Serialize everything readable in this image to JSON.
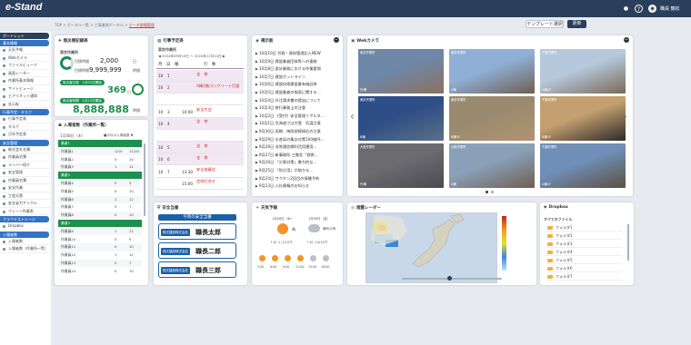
{
  "app": {
    "logo": "e-Stand",
    "user": "職員 鶴松"
  },
  "breadcrumb": {
    "items": [
      "TOP",
      "ポータル一覧",
      "工事業務ポータル"
    ],
    "current": "データ現場管理"
  },
  "toolbar": {
    "template_label": "テンプレート選択",
    "update_label": "更新"
  },
  "sidebar": {
    "sections": [
      {
        "title": "ポートレット",
        "items": []
      },
      {
        "title": "基本情報",
        "items": [
          "天気予報",
          "Webカメラ",
          "ファイルビューア",
          "画面レーダー",
          "作業所基本情報",
          "サイトビュージ",
          "ヒアリネット通知",
          "告示板"
        ]
      },
      {
        "title": "行事予定・タスク",
        "items": [
          "行事予定表",
          "タスク",
          "月年予定表"
        ]
      },
      {
        "title": "安全管理",
        "items": [
          "株式会社名簿",
          "作業員名簿",
          "メンバー紹介",
          "安全管理",
          "作業員名簿",
          "安全作業",
          "工程天票",
          "安全省力サイクル",
          "クレーン作業表"
        ]
      },
      {
        "title": "クラウドストレージ",
        "items": [
          "Dropbox"
        ]
      },
      {
        "title": "入場者数",
        "items": [
          "入場者数",
          "入場者数（作業所一覧）"
        ]
      }
    ]
  },
  "contract": {
    "title": "無災害記録表",
    "site_label": "東京作業所",
    "total_label": "目標時間",
    "total_value": "2,000",
    "total_unit": "日",
    "max_label": "目標時間",
    "max_value": "9,999,999",
    "max_unit": "時間",
    "badge1": "無災害日数　1月01日開始",
    "days_value": "369",
    "days_unit": "日",
    "badge2": "無災害時間　1月12日開始",
    "hours_value": "8,888,888",
    "hours_unit": "時間"
  },
  "attendance": {
    "title": "入場者数（作業所一覧）",
    "date": "1月08日（木）",
    "note": "■今月の入場者数 ▼",
    "rows": [
      {
        "name": "業者1",
        "type": "h"
      },
      {
        "name": "作業員1",
        "a": "1/10",
        "b": "11/20"
      },
      {
        "name": "作業員2",
        "a": "0",
        "b": "10"
      },
      {
        "name": "作業員3",
        "a": "1",
        "b": "12"
      },
      {
        "name": "業者2",
        "type": "h"
      },
      {
        "name": "作業員4",
        "a": "5",
        "b": "5"
      },
      {
        "name": "作業員5",
        "a": "0",
        "b": "10"
      },
      {
        "name": "作業員6",
        "a": "1",
        "b": "12"
      },
      {
        "name": "作業員7",
        "a": "5",
        "b": "7"
      },
      {
        "name": "作業員8",
        "a": "0",
        "b": "10"
      },
      {
        "name": "業者3",
        "type": "h"
      },
      {
        "name": "作業員9",
        "a": "1",
        "b": "12"
      },
      {
        "name": "作業員10",
        "a": "5",
        "b": "5"
      },
      {
        "name": "作業員11",
        "a": "0",
        "b": "10"
      },
      {
        "name": "作業員12",
        "a": "1",
        "b": "12"
      },
      {
        "name": "作業員13",
        "a": "5",
        "b": "7"
      },
      {
        "name": "作業員14",
        "a": "0",
        "b": "10"
      }
    ]
  },
  "schedule": {
    "title": "行事予定表",
    "site": "東京作業所",
    "range": "◀ 2024年09月10日 〜 2024年11月10日 ▶",
    "head": [
      "月",
      "日",
      "曜",
      "行　事"
    ],
    "rows": [
      {
        "d": "10",
        "w": "1",
        "t": "",
        "e": "全　休",
        "c": "red",
        "bg": "#f1e8f4"
      },
      {
        "d": "10",
        "w": "2",
        "t": "",
        "e": "A棟2階コンクリート打設",
        "c": "red",
        "bg": "#f1e8f4"
      },
      {
        "d": "",
        "w": "",
        "t": "",
        "e": "",
        "c": "",
        "bg": "#ffffff"
      },
      {
        "d": "10",
        "w": "3",
        "t": "10:00",
        "e": "安全大会",
        "c": "red",
        "bg": "#ffffff"
      },
      {
        "d": "10",
        "w": "4",
        "t": "",
        "e": "全　休",
        "c": "red",
        "bg": "#f1e8f4"
      },
      {
        "d": "",
        "w": "",
        "t": "",
        "e": "",
        "c": "",
        "bg": "#ffffff"
      },
      {
        "d": "10",
        "w": "5",
        "t": "",
        "e": "全　休",
        "c": "red",
        "bg": "#f1e8f4"
      },
      {
        "d": "10",
        "w": "6",
        "t": "",
        "e": "全　休",
        "c": "red",
        "bg": "#f1e8f4"
      },
      {
        "d": "10",
        "w": "7",
        "t": "13:30",
        "e": "安全協議会",
        "c": "red",
        "bg": "#ffffff"
      },
      {
        "d": "",
        "w": "",
        "t": "15:00",
        "e": "定例打合せ",
        "c": "red",
        "bg": "#ffffff"
      }
    ]
  },
  "notices": {
    "title": "掲示板",
    "items": [
      "10月10日 労務・資材管理記入NEW",
      "10月9日 建設業者団体等への連絡",
      "10月8日 設計業務における作業要領",
      "10月7日 建設ホットライン",
      "10月6日 建設技術建設業有価証券",
      "10月5日 建設業者の指導に関する…",
      "10月4日 外注請求書の提出について",
      "10月3日 夜行業務上の注意",
      "10月2日 《受付》安全管理リアルタ…",
      "10月1日 北海道では大雪　気温注意",
      "9月30日 雨期、梅雨前線接近の注意",
      "9月29日 水産局の集計対策100億円…",
      "9月28日 非常通信網利活用運用…",
      "9月27日 新事務所 三階北「鉄術…",
      "9月26日 「災害対策」暴力的な…",
      "9月25日 「防災用」が助かる…",
      "9月24日 ワクチン2回目の接種予約",
      "9月23日 入札情報のお知らせ"
    ]
  },
  "webcam": {
    "title": "Webカメラ",
    "tiles": [
      {
        "top": "東京作業所",
        "bot": "外構",
        "c1": "#6f87a8",
        "c2": "#8a7260"
      },
      {
        "top": "東京作業所",
        "bot": "A棟",
        "c1": "#8fb0d6",
        "c2": "#6d5f52"
      },
      {
        "top": "千葉作業所",
        "bot": "A棟1F",
        "c1": "#b6c8dc",
        "c2": "#7a6a58"
      },
      {
        "top": "東京作業所",
        "bot": "B棟",
        "c1": "#2d4e86",
        "c2": "#5c7084"
      },
      {
        "top": "東京作業所",
        "bot": "B棟1F",
        "c1": "#9a8a70",
        "c2": "#b29370"
      },
      {
        "top": "千葉作業所",
        "bot": "B棟1F",
        "c1": "#c4a070",
        "c2": "#2d2a28"
      },
      {
        "top": "大阪作業所",
        "bot": "外構",
        "c1": "#6b6b70",
        "c2": "#4a4a50"
      },
      {
        "top": "大阪作業所",
        "bot": "A棟",
        "c1": "#8aa0b8",
        "c2": "#6f6050"
      },
      {
        "top": "千葉作業所",
        "bot": "A棟1F",
        "c1": "#6f8eb8",
        "c2": "#5e5040"
      }
    ]
  },
  "safety": {
    "title": "安全当番",
    "banner": "今両の安全当番",
    "entries": [
      {
        "company": "株式建設株式会社",
        "name": "職長太郎"
      },
      {
        "company": "株式建設株式会社",
        "name": "職長二郎"
      },
      {
        "company": "株式建設株式会社",
        "name": "職長三郎"
      }
    ]
  },
  "weather": {
    "title": "天気予報",
    "loc1": "1月08日（木）",
    "loc2": "1月09日（金）",
    "w1": "晴",
    "w2": "曇時々晴",
    "temp1": "↑10 ↓-1/10℃",
    "temp2": "↑10 ↓0/10℃",
    "hours": [
      "3:00",
      "6:00",
      "9:00",
      "12:00",
      "15:00",
      "18:00"
    ]
  },
  "radar": {
    "title": "雨雲レーダー"
  },
  "dropbox": {
    "title": "Dropbox",
    "all_label": "すべてのファイル",
    "folders": [
      "フォルダ1",
      "フォルダ2",
      "フォルダ3",
      "フォルダ4",
      "フォルダ5",
      "フォルダ6",
      "フォルダ7"
    ]
  }
}
